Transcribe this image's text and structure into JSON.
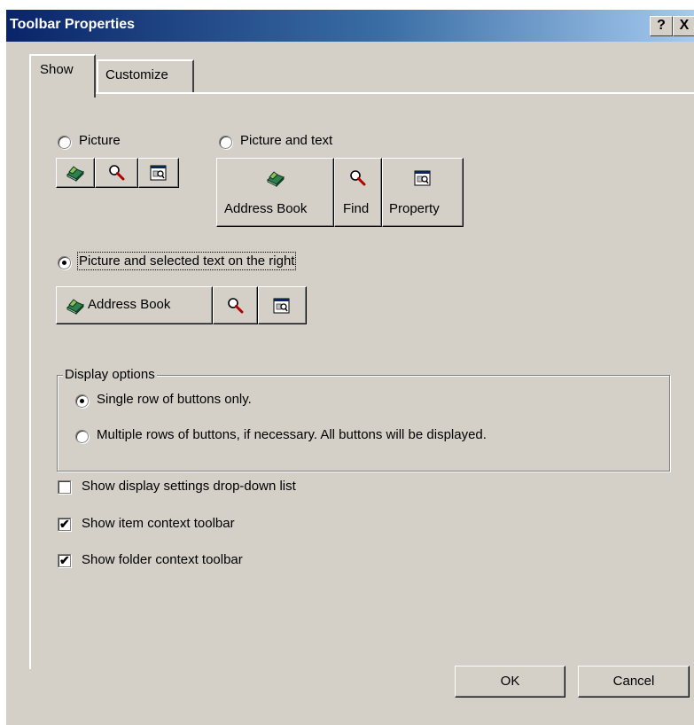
{
  "window": {
    "title": "Toolbar Properties",
    "help_glyph": "?",
    "close_glyph": "X",
    "title_gradient": [
      "#0a246a",
      "#a6caf0"
    ]
  },
  "tabs": [
    {
      "label": "Show",
      "active": true
    },
    {
      "label": "Customize",
      "active": false
    }
  ],
  "style_options": {
    "picture": {
      "label": "Picture",
      "selected": false
    },
    "picture_and_text": {
      "label": "Picture and text",
      "selected": false
    },
    "picture_selected_text_right": {
      "label": "Picture and selected text on the right",
      "selected": true
    }
  },
  "preview": {
    "address_book": "Address Book",
    "find": "Find",
    "property": "Property",
    "icons": [
      "address-book-icon",
      "find-magnifier-icon",
      "property-icon"
    ]
  },
  "display_options": {
    "legend": "Display options",
    "single_row": {
      "label": "Single row of buttons only.",
      "selected": true
    },
    "multiple_rows": {
      "label": "Multiple rows of buttons, if necessary.  All buttons will be displayed.",
      "selected": false
    }
  },
  "checkboxes": {
    "show_display_settings": {
      "label": "Show display settings drop-down list",
      "checked": false
    },
    "show_item_context": {
      "label": "Show item context toolbar",
      "checked": true
    },
    "show_folder_context": {
      "label": "Show folder context toolbar",
      "checked": true
    }
  },
  "buttons": {
    "ok": "OK",
    "cancel": "Cancel"
  },
  "check_glyph": "✔"
}
